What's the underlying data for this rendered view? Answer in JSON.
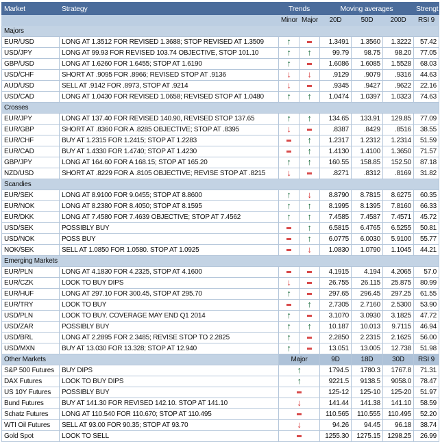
{
  "header": {
    "market": "Market",
    "strategy": "Strategy",
    "trends": "Trends",
    "moving_averages": "Moving averages",
    "strength": "Strength",
    "minor": "Minor",
    "major": "Major",
    "ma1": "20D",
    "ma2": "50D",
    "ma3": "200D",
    "rsi": "RSI 9"
  },
  "colors": {
    "header": "#4b6c9b",
    "up": "#16683a",
    "down": "#d42a2a"
  },
  "sections": [
    {
      "name": "Majors",
      "rows": [
        [
          "EUR/USD",
          "LONG AT 1.3512 FOR REVISED 1.3688; STOP REVISED AT 1.3509",
          "up",
          "flat",
          "1.3491",
          "1.3560",
          "1.3222",
          "57.42"
        ],
        [
          "USD/JPY",
          "LONG AT 99.93 FOR REVISED 103.74 OBJECTIVE, STOP 101.10",
          "up",
          "up",
          "99.79",
          "98.75",
          "98.20",
          "77.05"
        ],
        [
          "GBP/USD",
          "LONG AT 1.6260 FOR 1.6455; STOP AT 1.6190",
          "up",
          "flat",
          "1.6086",
          "1.6085",
          "1.5528",
          "68.03"
        ],
        [
          "USD/CHF",
          "SHORT AT .9095 FOR .8966; REVISED STOP AT .9136",
          "down",
          "down",
          ".9129",
          ".9079",
          ".9316",
          "44.63"
        ],
        [
          "AUD/USD",
          "SELL AT .9142 FOR .8973, STOP AT .9214",
          "down",
          "flat",
          ".9345",
          ".9427",
          ".9622",
          "22.16"
        ],
        [
          "USD/CAD",
          "LONG AT 1.0430 FOR REVISED 1.0658; REVISED STOP AT 1.0480",
          "up",
          "up",
          "1.0474",
          "1.0397",
          "1.0323",
          "74.63"
        ]
      ]
    },
    {
      "name": "Crosses",
      "rows": [
        [
          "EUR/JPY",
          "LONG AT 137.40 FOR REVISED 140.90, REVISED STOP 137.65",
          "up",
          "up",
          "134.65",
          "133.91",
          "129.85",
          "77.09"
        ],
        [
          "EUR/GBP",
          "SHORT AT .8360 FOR A .8285 OBJECTIVE; STOP AT .8395",
          "down",
          "flat",
          ".8387",
          ".8429",
          ".8516",
          "38.55"
        ],
        [
          "EUR/CHF",
          "BUY AT 1.2315 FOR 1.2415; STOP AT 1.2283",
          "flat",
          "up",
          "1.2317",
          "1.2312",
          "1.2314",
          "51.59"
        ],
        [
          "EUR/CAD",
          "BUY AT 1.4330 FOR 1.4740; STOP AT 1.4230",
          "flat",
          "up",
          "1.4130",
          "1.4100",
          "1.3650",
          "71.57"
        ],
        [
          "GBP/JPY",
          "LONG AT 164.60 FOR A 168.15; STOP AT 165.20",
          "up",
          "up",
          "160.55",
          "158.85",
          "152.50",
          "87.18"
        ],
        [
          "NZD/USD",
          "SHORT AT .8229 FOR A .8105 OBJECTIVE; REVISE STOP AT .8215",
          "down",
          "flat",
          ".8271",
          ".8312",
          ".8169",
          "31.82"
        ]
      ]
    },
    {
      "name": "Scandies",
      "rows": [
        [
          "EUR/SEK",
          "LONG AT 8.9100 FOR 9.0455; STOP AT 8.8600",
          "up",
          "down",
          "8.8790",
          "8.7815",
          "8.6275",
          "60.35"
        ],
        [
          "EUR/NOK",
          "LONG AT 8.2380 FOR 8.4050; STOP AT 8.1595",
          "up",
          "up",
          "8.1995",
          "8.1395",
          "7.8160",
          "66.33"
        ],
        [
          "EUR/DKK",
          "LONG AT 7.4580 FOR 7.4639 OBJECTIVE; STOP AT 7.4562",
          "up",
          "up",
          "7.4585",
          "7.4587",
          "7.4571",
          "45.72"
        ],
        [
          "USD/SEK",
          "POSSIBLY BUY",
          "flat",
          "up",
          "6.5815",
          "6.4765",
          "6.5255",
          "50.81"
        ],
        [
          "USD/NOK",
          "POSS BUY",
          "flat",
          "up",
          "6.0775",
          "6.0030",
          "5.9100",
          "55.77"
        ],
        [
          "NOK/SEK",
          "SELL AT 1.0850 FOR 1.0580. STOP AT 1.0925",
          "flat",
          "down",
          "1.0830",
          "1.0790",
          "1.1045",
          "44.21"
        ]
      ]
    },
    {
      "name": "Emerging Markets",
      "rows": [
        [
          "EUR/PLN",
          "LONG AT 4.1830 FOR 4.2325, STOP AT 4.1600",
          "flat",
          "flat",
          "4.1915",
          "4.194",
          "4.2065",
          "57.0"
        ],
        [
          "EUR/CZK",
          "LOOK TO BUY DIPS",
          "down",
          "flat",
          "26.755",
          "26.115",
          "25.875",
          "80.99"
        ],
        [
          "EUR/HUF",
          "LONG AT 297.10 FOR 300.45, STOP AT 295.70",
          "up",
          "flat",
          "297.65",
          "296.45",
          "297.25",
          "61.55"
        ],
        [
          "EUR/TRY",
          "LOOK TO BUY",
          "flat",
          "up",
          "2.7305",
          "2.7160",
          "2.5300",
          "53.90"
        ],
        [
          "USD/PLN",
          "LOOK TO BUY. COVERAGE MAY END Q1 2014",
          "up",
          "flat",
          "3.1070",
          "3.0930",
          "3.1825",
          "47.72"
        ],
        [
          "USD/ZAR",
          "POSSIBLY BUY",
          "up",
          "up",
          "10.187",
          "10.013",
          "9.7115",
          "46.94"
        ],
        [
          "USD/BRL",
          "LONG AT 2.2895 FOR 2.3485; REVISE STOP TO 2.2825",
          "up",
          "flat",
          "2.2850",
          "2.2315",
          "2.1625",
          "56.00"
        ],
        [
          "USD/MXN",
          "BUY AT 13.030 FOR 13.328; STOP AT 12.940",
          "up",
          "flat",
          "13.051",
          "13.005",
          "12.738",
          "51.98"
        ]
      ]
    }
  ],
  "other": {
    "name": "Other Markets",
    "major": "Major",
    "ma1": "9D",
    "ma2": "18D",
    "ma3": "30D",
    "rsi": "RSI 9",
    "rows": [
      [
        "S&P 500 Futures",
        "BUY DIPS",
        "up",
        "1794.5",
        "1780.3",
        "1767.8",
        "71.31"
      ],
      [
        "DAX Futures",
        "LOOK TO BUY DIPS",
        "up",
        "9221.5",
        "9138.5",
        "9058.0",
        "78.47"
      ],
      [
        "US 10Y Futures",
        "POSSIBLY BUY",
        "flat",
        "125-12",
        "125-10",
        "125-20",
        "51.97"
      ],
      [
        "Bund Futures",
        "BUY AT 141.30 FOR REVISED 142.10. STOP AT 141.10",
        "down",
        "141.44",
        "141.38",
        "141.10",
        "58.59"
      ],
      [
        "Schatz Futures",
        "LONG AT 110.540 FOR 110.670; STOP AT 110.495",
        "flat",
        "110.565",
        "110.555",
        "110.495",
        "52.20"
      ],
      [
        "WTI Oil Futures",
        "SELL AT 93.00 FOR 90.35; STOP AT 93.70",
        "down",
        "94.26",
        "94.45",
        "96.18",
        "38.74"
      ],
      [
        "Gold Spot",
        "LOOK TO SELL",
        "flat",
        "1255.30",
        "1275.15",
        "1298.25",
        "26.99"
      ]
    ]
  }
}
